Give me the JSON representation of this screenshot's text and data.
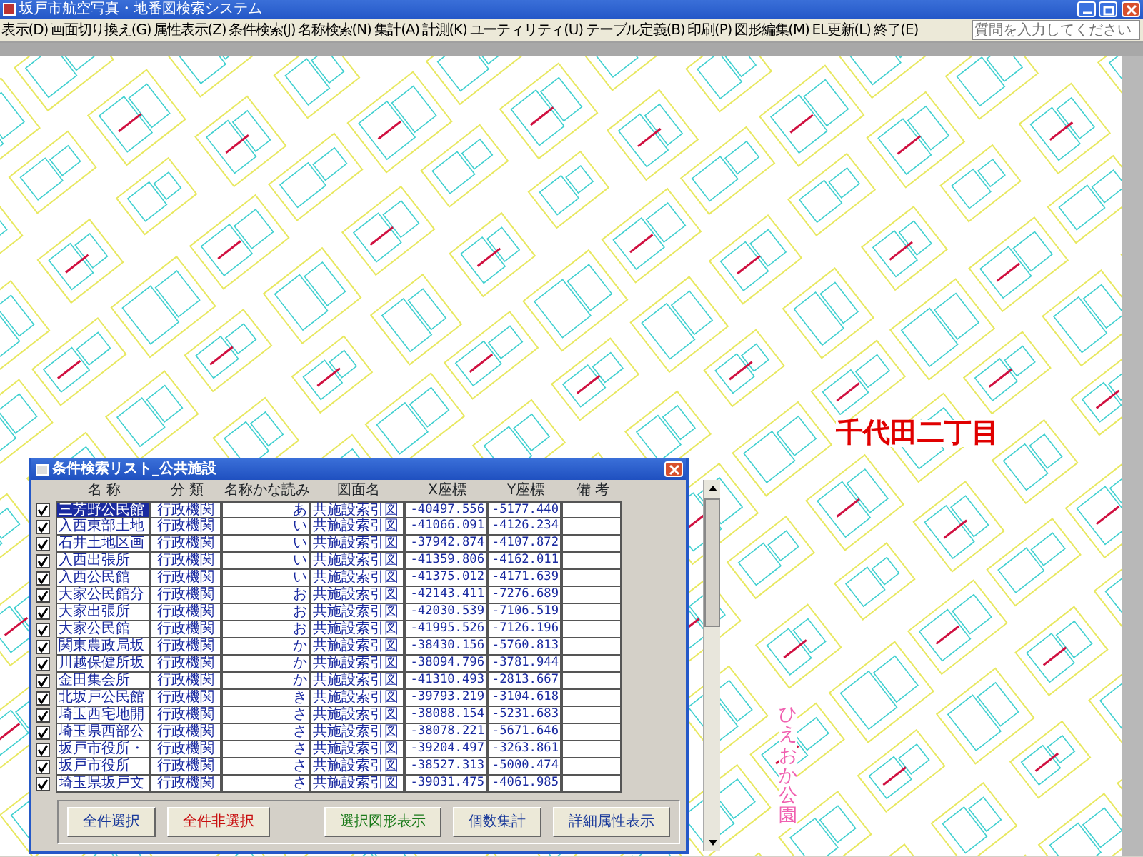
{
  "window": {
    "title": "坂戸市航空写真・地番図検索システム"
  },
  "menu": [
    "表示(D)",
    "画面切り換え(G)",
    "属性表示(Z)",
    "条件検索(J)",
    "名称検索(N)",
    "集計(A)",
    "計測(K)",
    "ユーティリティ(U)",
    "テーブル定義(B)",
    "印刷(P)",
    "図形編集(M)",
    "EL更新(L)",
    "終了(E)"
  ],
  "help_box": {
    "placeholder": "質問を入力してください"
  },
  "map": {
    "labels": [
      {
        "kind": "district",
        "text": "千代田二丁目"
      },
      {
        "kind": "park",
        "text": "ひえおか公園"
      }
    ]
  },
  "dialog": {
    "title": "条件検索リスト_公共施設",
    "columns": [
      "名 称",
      "分 類",
      "名称かな読み",
      "図面名",
      "X座標",
      "Y座標",
      "備 考"
    ],
    "rows": [
      {
        "checked": true,
        "selected": true,
        "cells": [
          "三芳野公民館",
          "行政機関",
          "あ",
          "共施設索引図",
          "-40497.556",
          "-5177.440"
        ]
      },
      {
        "checked": true,
        "selected": false,
        "cells": [
          "入西東部土地",
          "行政機関",
          "い",
          "共施設索引図",
          "-41066.091",
          "-4126.234"
        ]
      },
      {
        "checked": true,
        "selected": false,
        "cells": [
          "石井土地区画",
          "行政機関",
          "い",
          "共施設索引図",
          "-37942.874",
          "-4107.872"
        ]
      },
      {
        "checked": true,
        "selected": false,
        "cells": [
          "入西出張所",
          "行政機関",
          "い",
          "共施設索引図",
          "-41359.806",
          "-4162.011"
        ]
      },
      {
        "checked": true,
        "selected": false,
        "cells": [
          "入西公民館",
          "行政機関",
          "い",
          "共施設索引図",
          "-41375.012",
          "-4171.639"
        ]
      },
      {
        "checked": true,
        "selected": false,
        "cells": [
          "大家公民館分",
          "行政機関",
          "お",
          "共施設索引図",
          "-42143.411",
          "-7276.689"
        ]
      },
      {
        "checked": true,
        "selected": false,
        "cells": [
          "大家出張所",
          "行政機関",
          "お",
          "共施設索引図",
          "-42030.539",
          "-7106.519"
        ]
      },
      {
        "checked": true,
        "selected": false,
        "cells": [
          "大家公民館",
          "行政機関",
          "お",
          "共施設索引図",
          "-41995.526",
          "-7126.196"
        ]
      },
      {
        "checked": true,
        "selected": false,
        "cells": [
          "関東農政局坂",
          "行政機関",
          "か",
          "共施設索引図",
          "-38430.156",
          "-5760.813"
        ]
      },
      {
        "checked": true,
        "selected": false,
        "cells": [
          "川越保健所坂",
          "行政機関",
          "か",
          "共施設索引図",
          "-38094.796",
          "-3781.944"
        ]
      },
      {
        "checked": true,
        "selected": false,
        "cells": [
          "金田集会所",
          "行政機関",
          "か",
          "共施設索引図",
          "-41310.493",
          "-2813.667"
        ]
      },
      {
        "checked": true,
        "selected": false,
        "cells": [
          "北坂戸公民館",
          "行政機関",
          "き",
          "共施設索引図",
          "-39793.219",
          "-3104.618"
        ]
      },
      {
        "checked": true,
        "selected": false,
        "cells": [
          "埼玉西宅地開",
          "行政機関",
          "さ",
          "共施設索引図",
          "-38088.154",
          "-5231.683"
        ]
      },
      {
        "checked": true,
        "selected": false,
        "cells": [
          "埼玉県西部公",
          "行政機関",
          "さ",
          "共施設索引図",
          "-38078.221",
          "-5671.646"
        ]
      },
      {
        "checked": true,
        "selected": false,
        "cells": [
          "坂戸市役所・",
          "行政機関",
          "さ",
          "共施設索引図",
          "-39204.497",
          "-3263.861"
        ]
      },
      {
        "checked": true,
        "selected": false,
        "cells": [
          "坂戸市役所",
          "行政機関",
          "さ",
          "共施設索引図",
          "-38527.313",
          "-5000.474"
        ]
      },
      {
        "checked": true,
        "selected": false,
        "cells": [
          "埼玉県坂戸文",
          "行政機関",
          "さ",
          "共施設索引図",
          "-39031.475",
          "-4061.985"
        ]
      }
    ],
    "buttons": [
      {
        "label": "全件選択",
        "color": "#1a3a9a"
      },
      {
        "label": "全件非選択",
        "color": "#c81010"
      },
      {
        "label": "選択図形表示",
        "color": "#1a7a1a"
      },
      {
        "label": "個数集計",
        "color": "#1a3a9a"
      },
      {
        "label": "詳細属性表示",
        "color": "#1a3a9a"
      }
    ]
  }
}
